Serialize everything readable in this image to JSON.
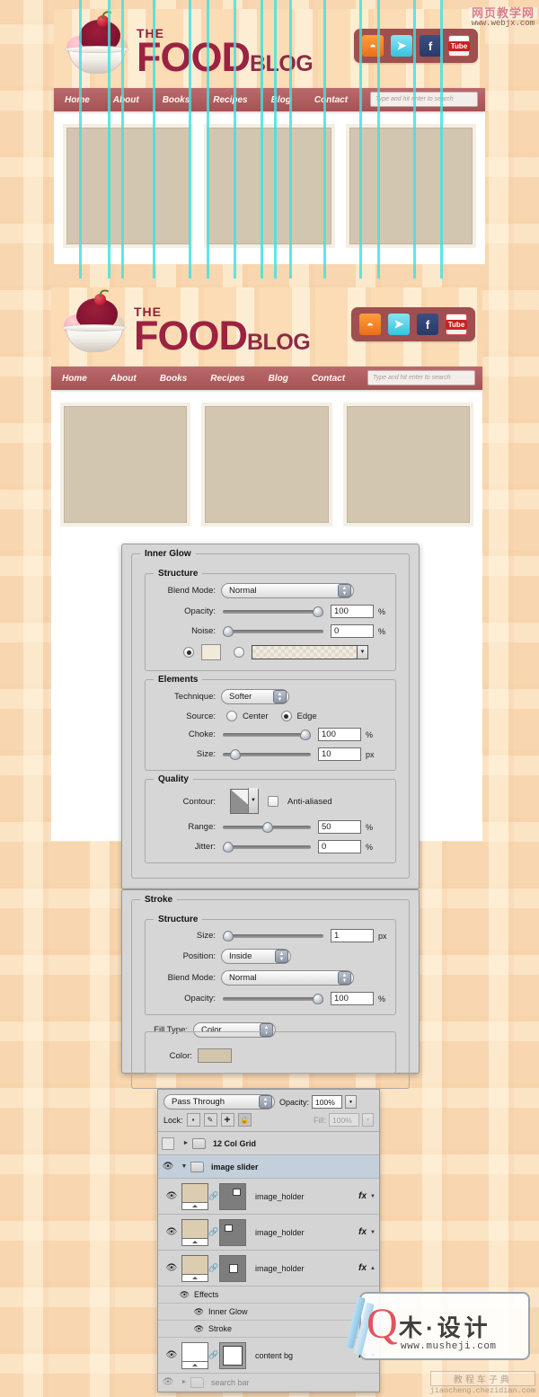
{
  "site": {
    "logo": {
      "the": "THE",
      "food": "FOOD",
      "blog": "BLOG",
      "icon": "sundae-icon"
    },
    "nav": [
      {
        "label": "Home"
      },
      {
        "label": "About"
      },
      {
        "label": "Books"
      },
      {
        "label": "Recipes"
      },
      {
        "label": "Blog"
      },
      {
        "label": "Contact"
      }
    ],
    "search": {
      "placeholder": "Type and hit enter to search",
      "value": ""
    },
    "social": [
      {
        "name": "rss-icon",
        "glyph": "◠"
      },
      {
        "name": "twitter-icon",
        "glyph": "✈"
      },
      {
        "name": "facebook-icon",
        "glyph": "f"
      },
      {
        "name": "youtube-icon",
        "glyph": "Tube"
      }
    ],
    "slider_placeholders": [
      "image_holder",
      "image_holder",
      "image_holder"
    ],
    "colors": {
      "nav_bg": "#a65254",
      "logo_red": "#9c2242",
      "placeholder": "#d2c6b0",
      "plaid": "#f8d7b0"
    }
  },
  "inner_glow": {
    "title": "Inner Glow",
    "structure": {
      "legend": "Structure",
      "blend_mode_label": "Blend Mode:",
      "blend_mode_value": "Normal",
      "opacity_label": "Opacity:",
      "opacity_value": "100",
      "opacity_unit": "%",
      "noise_label": "Noise:",
      "noise_value": "0",
      "noise_unit": "%",
      "color_radio_selected": true,
      "gradient_radio_selected": false,
      "color_swatch": "#f2ead8"
    },
    "elements": {
      "legend": "Elements",
      "technique_label": "Technique:",
      "technique_value": "Softer",
      "source_label": "Source:",
      "source_center": "Center",
      "source_edge": "Edge",
      "source_selected": "Edge",
      "choke_label": "Choke:",
      "choke_value": "100",
      "choke_unit": "%",
      "size_label": "Size:",
      "size_value": "10",
      "size_unit": "px"
    },
    "quality": {
      "legend": "Quality",
      "contour_label": "Contour:",
      "antialiased_label": "Anti-aliased",
      "antialiased_checked": false,
      "range_label": "Range:",
      "range_value": "50",
      "range_unit": "%",
      "jitter_label": "Jitter:",
      "jitter_value": "0",
      "jitter_unit": "%"
    }
  },
  "stroke": {
    "title": "Stroke",
    "structure": {
      "legend": "Structure",
      "size_label": "Size:",
      "size_value": "1",
      "size_unit": "px",
      "position_label": "Position:",
      "position_value": "Inside",
      "blend_mode_label": "Blend Mode:",
      "blend_mode_value": "Normal",
      "opacity_label": "Opacity:",
      "opacity_value": "100",
      "opacity_unit": "%"
    },
    "fill": {
      "fill_type_label": "Fill Type:",
      "fill_type_value": "Color",
      "color_label": "Color:",
      "color_value": "#d3c5ab"
    }
  },
  "layers_panel": {
    "blend_mode": "Pass Through",
    "opacity_label": "Opacity:",
    "opacity_value": "100%",
    "lock_label": "Lock:",
    "lock_buttons": [
      "lock-transparent-pixels",
      "lock-image-pixels",
      "lock-position",
      "lock-all"
    ],
    "fill_label": "Fill:",
    "fill_value": "100%",
    "rows": [
      {
        "type": "group",
        "name": "12 Col Grid",
        "visible": false,
        "expanded": false,
        "selected": false
      },
      {
        "type": "group",
        "name": "image slider",
        "visible": true,
        "expanded": true,
        "selected": true
      },
      {
        "type": "layer",
        "name": "image_holder",
        "visible": true,
        "fx": "fx",
        "mask_pos": "top-right"
      },
      {
        "type": "layer",
        "name": "image_holder",
        "visible": true,
        "fx": "fx",
        "mask_pos": "top-left"
      },
      {
        "type": "layer",
        "name": "image_holder",
        "visible": true,
        "fx": "fx",
        "mask_pos": "center"
      },
      {
        "type": "effects",
        "name": "Effects",
        "visible": true
      },
      {
        "type": "effect",
        "name": "Inner Glow",
        "visible": true
      },
      {
        "type": "effect",
        "name": "Stroke",
        "visible": true
      },
      {
        "type": "layer",
        "name": "content bg",
        "visible": true,
        "fx": "fx",
        "white": true
      },
      {
        "type": "group",
        "name": "search bar",
        "visible": true,
        "dimmed": true
      }
    ]
  },
  "watermarks": {
    "top": {
      "cn": "网页教学网",
      "url": "www.webjx.com"
    },
    "middle": {
      "cn": "木·设计",
      "url": "www.musheji.com"
    },
    "bottom": {
      "cn": "教程车子典",
      "url": "jiaocheng.chezidian.com"
    }
  }
}
